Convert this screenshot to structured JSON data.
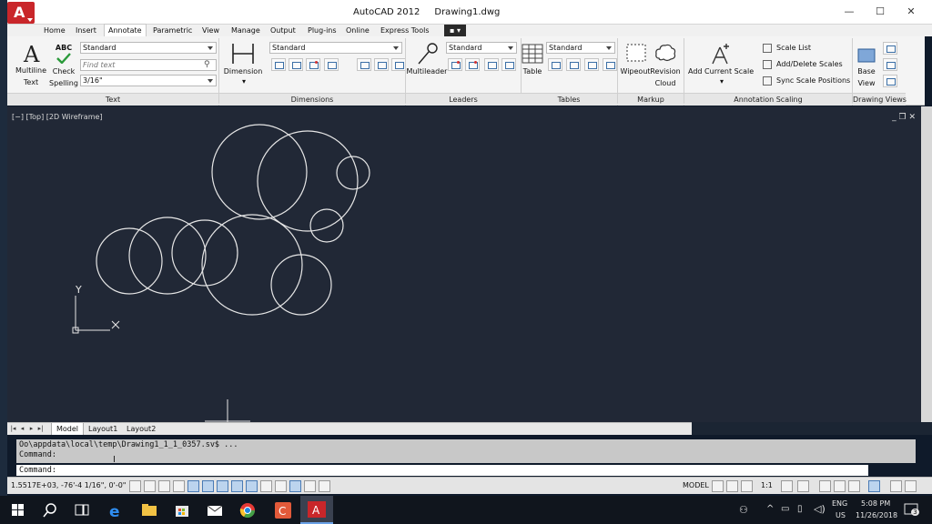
{
  "window": {
    "app_title": "AutoCAD 2012",
    "doc_title": "Drawing1.dwg",
    "minimize": "—",
    "maximize": "☐",
    "close": "✕"
  },
  "ribbon_tabs": [
    {
      "label": "Home"
    },
    {
      "label": "Insert"
    },
    {
      "label": "Annotate"
    },
    {
      "label": "Parametric"
    },
    {
      "label": "View"
    },
    {
      "label": "Manage"
    },
    {
      "label": "Output"
    },
    {
      "label": "Plug-ins"
    },
    {
      "label": "Online"
    },
    {
      "label": "Express Tools"
    }
  ],
  "ribbon": {
    "text_panel": {
      "multiline_label_1": "Multiline",
      "multiline_label_2": "Text",
      "abc": "ABC",
      "check_label_1": "Check",
      "check_label_2": "Spelling",
      "style_value": "Standard",
      "find_placeholder": "Find text",
      "height_value": "3/16\"",
      "title": "Text"
    },
    "dimensions_panel": {
      "dimension_label": "Dimension",
      "style_value": "Standard",
      "title": "Dimensions"
    },
    "leaders_panel": {
      "multileader_label": "Multileader",
      "style_value": "Standard",
      "title": "Leaders"
    },
    "tables_panel": {
      "table_label": "Table",
      "style_value": "Standard",
      "title": "Tables"
    },
    "markup_panel": {
      "wipeout_label": "Wipeout",
      "revision_label_1": "Revision",
      "revision_label_2": "Cloud",
      "title": "Markup"
    },
    "annotation_scaling_panel": {
      "add_current_scale": "Add Current Scale",
      "scale_list": "Scale List",
      "add_delete_scales": "Add/Delete Scales",
      "sync_scale_positions": "Sync Scale Positions",
      "title": "Annotation Scaling"
    },
    "drawing_views_panel": {
      "base_label_1": "Base",
      "base_label_2": "View",
      "title": "Drawing Views"
    }
  },
  "viewport": {
    "label": "[−] [Top] [2D Wireframe]",
    "controls": "_ ❐ ✕",
    "ucs_x": "X",
    "ucs_y": "Y"
  },
  "layout_tabs": [
    {
      "label": "Model"
    },
    {
      "label": "Layout1"
    },
    {
      "label": "Layout2"
    }
  ],
  "command": {
    "history_line_1": "Oo\\appdata\\local\\temp\\Drawing1_1_1_0357.sv$ ...",
    "history_line_2": "Command:",
    "prompt": "Command:"
  },
  "status": {
    "coordinates": "1.5517E+03,  -76'-4 1/16\", 0'-0\"",
    "model": "MODEL",
    "scale": "1:1"
  },
  "taskbar": {
    "lang_1": "ENG",
    "lang_2": "US",
    "time": "5:08 PM",
    "date": "11/26/2018",
    "notifications": "3"
  },
  "colors": {
    "viewport_bg": "#212836",
    "drawing_stroke": "#e8e8e8",
    "autocad_red": "#c9262a"
  }
}
